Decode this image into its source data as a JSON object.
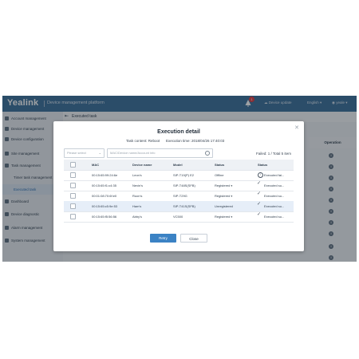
{
  "topbar": {
    "logo": "Yealink",
    "platform": "Device management platform",
    "notification_count": "1",
    "device_update": "Device update",
    "language": "English ▾",
    "user": "yeale ▾"
  },
  "sidebar": {
    "items": [
      {
        "label": "Account management"
      },
      {
        "label": "Device management"
      },
      {
        "label": "Device configuration"
      },
      {
        "label": "Site management"
      },
      {
        "label": "Task management"
      },
      {
        "label": "Timer task management"
      },
      {
        "label": "Executed task"
      },
      {
        "label": "Dashboard"
      },
      {
        "label": "Device diagnostic"
      },
      {
        "label": "Alarm management"
      },
      {
        "label": "System management"
      }
    ]
  },
  "main": {
    "page_title": "Executed task",
    "operation_header": "Operation"
  },
  "modal": {
    "title": "Execution detail",
    "task_content": "Task content: Reboot",
    "execution_time": "Execution time: 2018/04/26 17:40:03",
    "select_placeholder": "Please select",
    "search_placeholder": "MAC/Device name/Account info",
    "summary": "Failed: 1 / Total 5 item",
    "columns": [
      "MAC",
      "Device name",
      "Model",
      "Status",
      "Status"
    ],
    "rows": [
      {
        "mac": "00:15:65:99:24:6e",
        "name": "Leon's",
        "model": "SIP-T19(P) E2",
        "status": "Offline",
        "status_caret": "",
        "result": "Executed fai...",
        "result_icon": "info"
      },
      {
        "mac": "00:15:65:f1:c4:35",
        "name": "Nevin's",
        "model": "SIP-T48S(SFB)",
        "status": "Registered",
        "status_caret": "▾",
        "result": "Executed su...",
        "result_icon": "check"
      },
      {
        "mac": "00:01:08:70:6f:e0",
        "name": "Ruon's",
        "model": "SIP-T29G",
        "status": "Registered",
        "status_caret": "▾",
        "result": "Executed su...",
        "result_icon": "check"
      },
      {
        "mac": "00:15:65:c5:9e:53",
        "name": "Ham's",
        "model": "SIP-T41S(SFB)",
        "status": "Unregistered",
        "status_caret": "",
        "result": "Executed su...",
        "result_icon": "check"
      },
      {
        "mac": "00:15:65:f5:56:56",
        "name": "Abby's",
        "model": "VC500",
        "status": "Registered",
        "status_caret": "▾",
        "result": "Executed su...",
        "result_icon": "check"
      }
    ],
    "retry_label": "Retry",
    "close_label": "Close"
  }
}
